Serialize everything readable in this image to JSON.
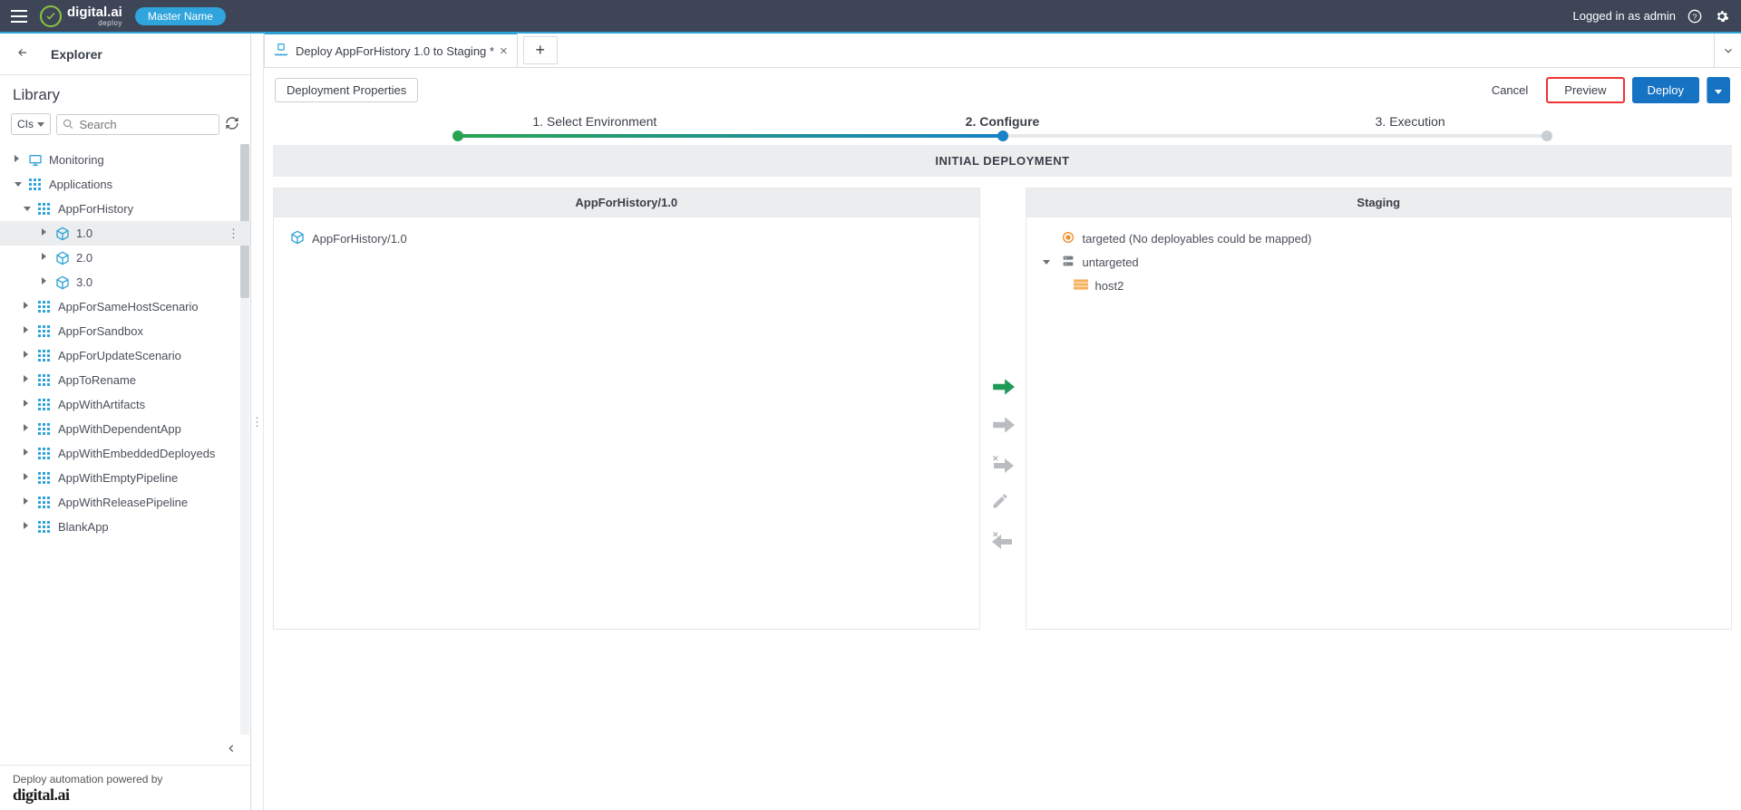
{
  "topbar": {
    "master_name": "Master Name",
    "logged_in": "Logged in as admin",
    "brand": "digital.ai",
    "brand_sub": "deploy"
  },
  "explorer": {
    "title": "Explorer",
    "library": "Library",
    "cls_label": "CIs",
    "search_placeholder": "Search"
  },
  "tree": {
    "monitoring": "Monitoring",
    "applications": "Applications",
    "app_for_history": "AppForHistory",
    "v10": "1.0",
    "v20": "2.0",
    "v30": "3.0",
    "app_same_host": "AppForSameHostScenario",
    "app_sandbox": "AppForSandbox",
    "app_update": "AppForUpdateScenario",
    "app_rename": "AppToRename",
    "app_artifacts": "AppWithArtifacts",
    "app_dependent": "AppWithDependentApp",
    "app_embedded": "AppWithEmbeddedDeployeds",
    "app_empty_pipe": "AppWithEmptyPipeline",
    "app_release_pipe": "AppWithReleasePipeline",
    "app_blank": "BlankApp"
  },
  "footer": {
    "powered": "Deploy automation powered by",
    "brand": "digital.ai"
  },
  "tab": {
    "label": "Deploy AppForHistory 1.0 to Staging *"
  },
  "toolbar": {
    "deployment_properties": "Deployment Properties",
    "cancel": "Cancel",
    "preview": "Preview",
    "deploy": "Deploy"
  },
  "steps": {
    "s1": "1. Select Environment",
    "s2": "2. Configure",
    "s3": "3. Execution"
  },
  "banner": "INITIAL DEPLOYMENT",
  "left_panel": {
    "title": "AppForHistory/1.0",
    "item": "AppForHistory/1.0"
  },
  "right_panel": {
    "title": "Staging",
    "targeted": "targeted (No deployables could be mapped)",
    "untargeted": "untargeted",
    "host": "host2"
  }
}
